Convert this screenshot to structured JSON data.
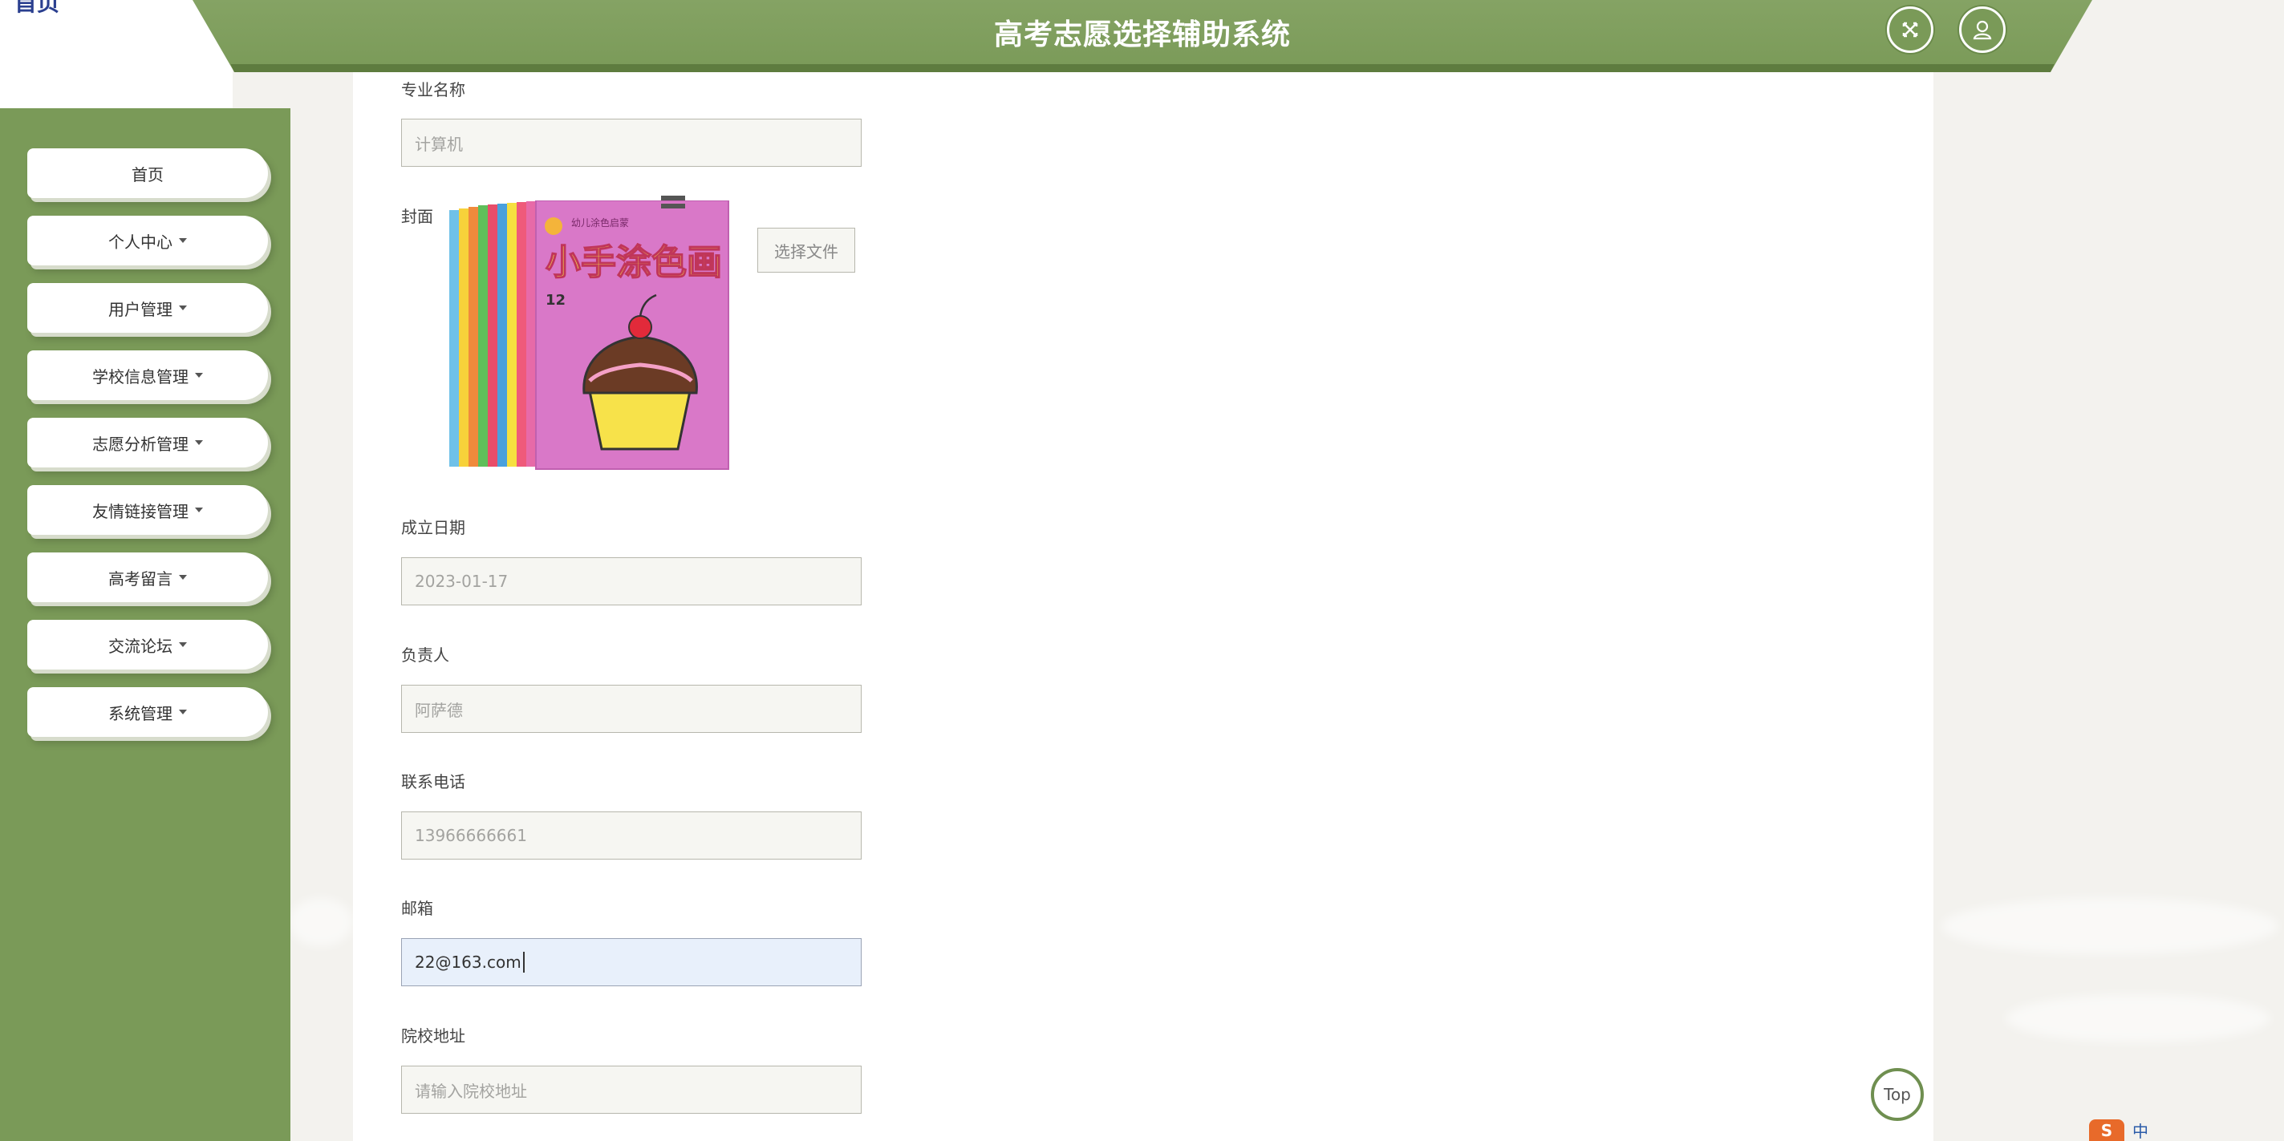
{
  "logo": {
    "text": "首页"
  },
  "header": {
    "title": "高考志愿选择辅助系统",
    "close_icon": "close-icon",
    "user_icon": "user-icon"
  },
  "sidebar": {
    "items": [
      {
        "label": "首页",
        "has_caret": false
      },
      {
        "label": "个人中心",
        "has_caret": true
      },
      {
        "label": "用户管理",
        "has_caret": true
      },
      {
        "label": "学校信息管理",
        "has_caret": true
      },
      {
        "label": "志愿分析管理",
        "has_caret": true
      },
      {
        "label": "友情链接管理",
        "has_caret": true
      },
      {
        "label": "高考留言",
        "has_caret": true
      },
      {
        "label": "交流论坛",
        "has_caret": true
      },
      {
        "label": "系统管理",
        "has_caret": true
      }
    ]
  },
  "form": {
    "major": {
      "label": "专业名称",
      "value": "计算机"
    },
    "cover": {
      "label": "封面",
      "file_button": "选择文件",
      "image_text": "小手涂色画",
      "image_number": "12"
    },
    "founded": {
      "label": "成立日期",
      "value": "2023-01-17"
    },
    "manager": {
      "label": "负责人",
      "value": "阿萨德"
    },
    "phone": {
      "label": "联系电话",
      "value": "13966666661"
    },
    "email": {
      "label": "邮箱",
      "value": "22@163.com"
    },
    "address": {
      "label": "院校地址",
      "placeholder": "请输入院校地址"
    }
  },
  "top_button": {
    "label": "Top"
  },
  "tray": {
    "text": "中"
  },
  "colors": {
    "primary": "#7a9a58",
    "primary_dark": "#5e7c3f",
    "input_bg": "#f6f6f2",
    "input_active_bg": "#e8f0fb"
  }
}
